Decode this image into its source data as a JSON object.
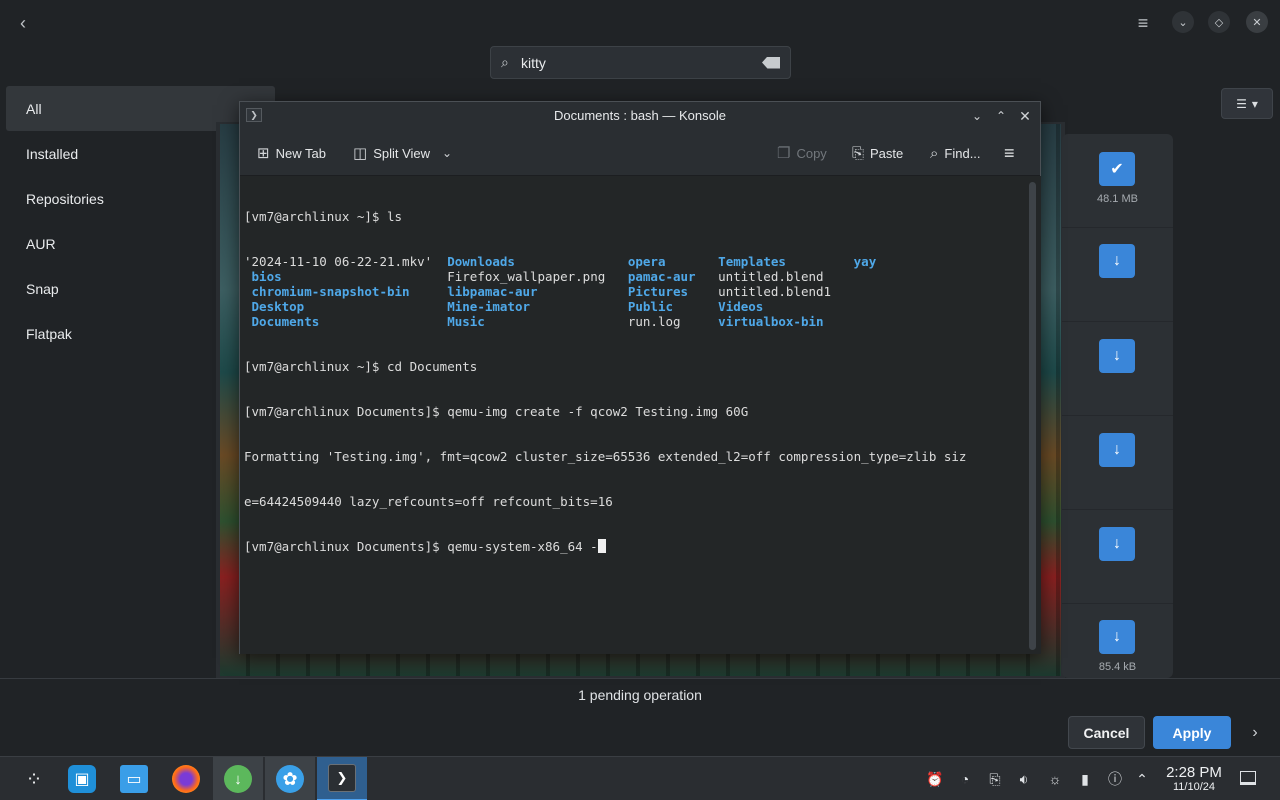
{
  "discover": {
    "search": {
      "value": "kitty"
    },
    "sidebar": [
      {
        "label": "All"
      },
      {
        "label": "Installed"
      },
      {
        "label": "Repositories"
      },
      {
        "label": "AUR"
      },
      {
        "label": "Snap"
      },
      {
        "label": "Flatpak"
      }
    ],
    "sizes": {
      "first": "48.1 MB",
      "last": "85.4 kB"
    },
    "pending": "1 pending operation",
    "cancel_label": "Cancel",
    "apply_label": "Apply"
  },
  "konsole": {
    "title": "Documents : bash — Konsole",
    "toolbar": {
      "new_tab": "New Tab",
      "split_view": "Split View",
      "copy": "Copy",
      "paste": "Paste",
      "find": "Find..."
    },
    "terminal": {
      "l0": "[vm7@archlinux ~]$ ls",
      "ls": [
        [
          "'2024-11-10 06-22-21.mkv'",
          "Downloads",
          "opera",
          "Templates",
          "yay"
        ],
        [
          " bios",
          "Firefox_wallpaper.png",
          "pamac-aur",
          "untitled.blend",
          ""
        ],
        [
          " chromium-snapshot-bin",
          "libpamac-aur",
          "Pictures",
          "untitled.blend1",
          ""
        ],
        [
          " Desktop",
          "Mine-imator",
          "Public",
          "Videos",
          ""
        ],
        [
          " Documents",
          "Music",
          "run.log",
          "virtualbox-bin",
          ""
        ]
      ],
      "l6": "[vm7@archlinux ~]$ cd Documents",
      "l7": "[vm7@archlinux Documents]$ qemu-img create -f qcow2 Testing.img 60G",
      "l8": "Formatting 'Testing.img', fmt=qcow2 cluster_size=65536 extended_l2=off compression_type=zlib siz",
      "l9": "e=64424509440 lazy_refcounts=off refcount_bits=16",
      "l10": "[vm7@archlinux Documents]$ qemu-system-x86_64 -"
    }
  },
  "taskbar": {
    "time": "2:28 PM",
    "date": "11/10/24"
  },
  "colors": {
    "accent": "#3a86d9",
    "directory": "#4fa8e8",
    "terminal_bg": "#232627"
  }
}
